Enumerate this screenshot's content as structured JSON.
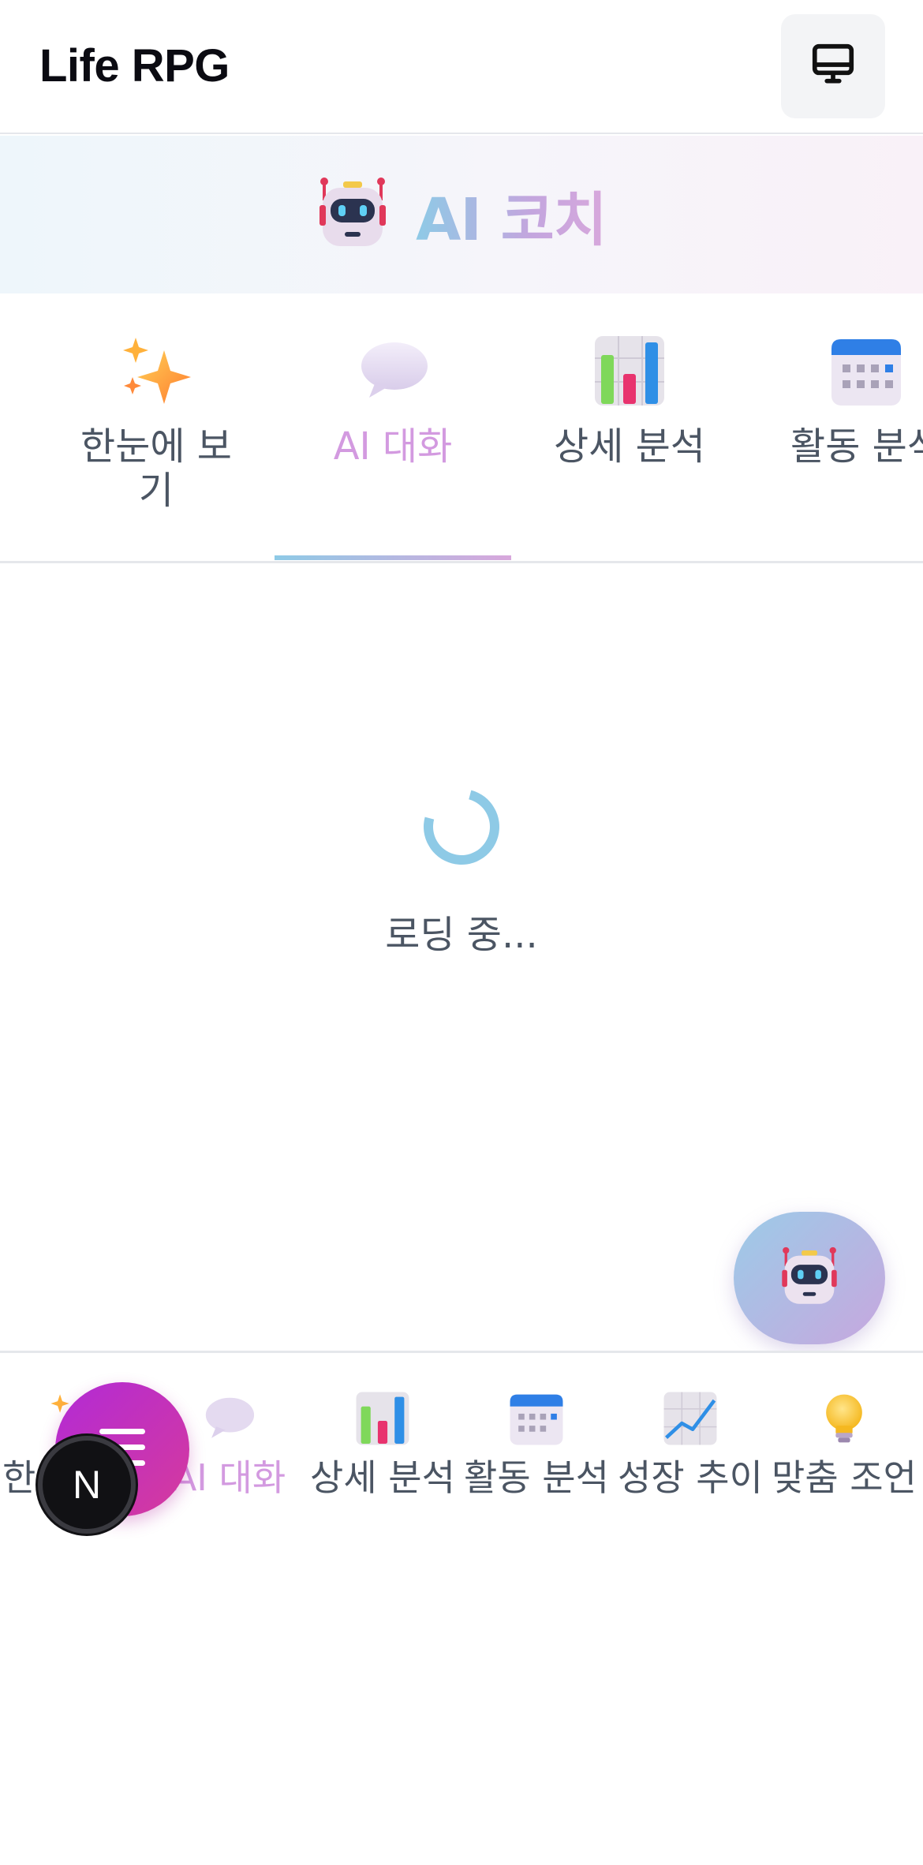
{
  "header": {
    "app_title": "Life RPG",
    "desktop_button_icon": "monitor-icon"
  },
  "banner": {
    "icon": "robot-icon",
    "title": "AI 코치"
  },
  "tabs": [
    {
      "label": "한눈에 보기",
      "icon": "sparkles-icon",
      "active": false
    },
    {
      "label": "AI 대화",
      "icon": "speech-bubble-icon",
      "active": true
    },
    {
      "label": "상세 분석",
      "icon": "bar-chart-icon",
      "active": false
    },
    {
      "label": "활동 분석",
      "icon": "calendar-icon",
      "active": false
    }
  ],
  "loading": {
    "text": "로딩 중..."
  },
  "fab": {
    "icon": "robot-icon"
  },
  "bottom_nav": [
    {
      "label": "한눈에 보기",
      "icon": "sparkles-icon",
      "active": false
    },
    {
      "label": "AI 대화",
      "icon": "speech-bubble-icon",
      "active": true
    },
    {
      "label": "상세 분석",
      "icon": "bar-chart-icon",
      "active": false
    },
    {
      "label": "활동 분석",
      "icon": "calendar-icon",
      "active": false
    },
    {
      "label": "성장 추이",
      "icon": "trend-chart-icon",
      "active": false
    },
    {
      "label": "맞춤 조언",
      "icon": "lightbulb-icon",
      "active": false
    }
  ],
  "menu_fab": {
    "icon": "menu-icon"
  },
  "badge": {
    "letter": "N"
  },
  "colors": {
    "accent_blue": "#8ecae6",
    "accent_pink": "#d39ae0",
    "menu_gradient_start": "#b22ad6",
    "menu_gradient_end": "#d63a9c"
  }
}
